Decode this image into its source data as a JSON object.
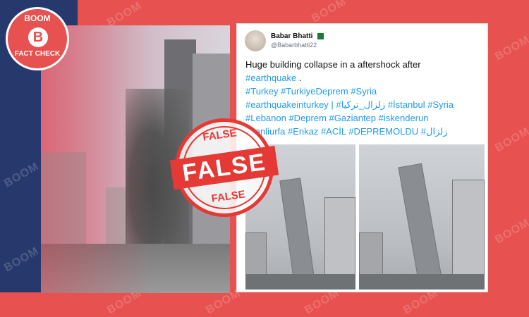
{
  "logo": {
    "top_text": "BOOM",
    "mark": "B",
    "bottom_text": "FACT CHECK"
  },
  "watermark": "BOOM",
  "stamp": {
    "banner": "FALSE",
    "top": "FALSE",
    "bottom": "FALSE"
  },
  "tweet": {
    "author_name": "Babar Bhatti",
    "handle": "@Babarbhatti22",
    "flag_icon": "pakistan-flag-icon",
    "lines": [
      [
        "Huge building collapse in a aftershock after"
      ],
      [
        "#earthquake",
        " ."
      ],
      [
        "#Turkey #TurkiyeDeprem  #Syria"
      ],
      [
        "#earthquakeinturkey | #زلزال_تركيا  #İstanbul #Syria"
      ],
      [
        "#Lebanon #Deprem #Gaziantep #iskenderun"
      ],
      [
        "#şanliurfa #Enkaz #ACİL  #DEPREMOLDU  #زلزال"
      ]
    ]
  },
  "colors": {
    "brand_red": "#e7514f",
    "brand_navy": "#27386c",
    "stamp_red": "#e53935",
    "hashtag_blue": "#1d9bf0"
  }
}
